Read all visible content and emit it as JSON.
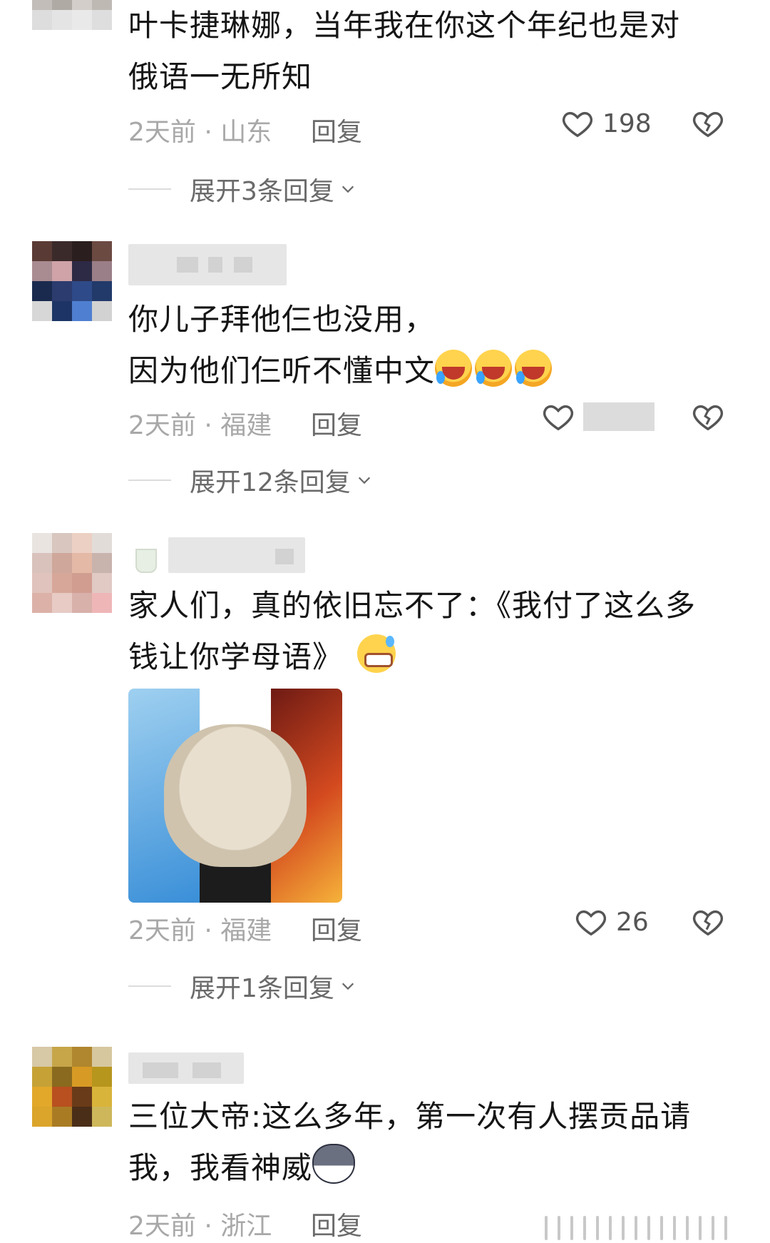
{
  "comments": [
    {
      "text_lines": [
        "叶卡捷琳娜，当年我在你这个年纪也是对",
        "俄语一无所知"
      ],
      "meta": {
        "time_location": "2天前 · 山东",
        "reply_label": "回复"
      },
      "likes": "198",
      "expand_label": "展开3条回复"
    },
    {
      "text_lines": [
        "你儿子拜他仨也没用，",
        "因为他们仨听不懂中文"
      ],
      "meta": {
        "time_location": "2天前 · 福建",
        "reply_label": "回复"
      },
      "likes": "",
      "expand_label": "展开12条回复"
    },
    {
      "text_lines": [
        "家人们，真的依旧忘不了：《我付了这么多",
        "钱让你学母语》"
      ],
      "meta": {
        "time_location": "2天前 · 福建",
        "reply_label": "回复"
      },
      "likes": "26",
      "expand_label": "展开1条回复"
    },
    {
      "text_lines": [
        "三位大帝:这么多年，第一次有人摆贡品请",
        "我，我看神威"
      ],
      "meta": {
        "time_location": "2天前 · 浙江",
        "reply_label": "回复"
      },
      "likes": "",
      "expand_label": ""
    }
  ],
  "colors": {
    "background": "#ffffff",
    "text": "#151515",
    "meta_text": "#a8a8a8",
    "reply_text": "#6a6a6a"
  },
  "icons": {
    "like": "heart-outline-icon",
    "dislike": "broken-heart-icon",
    "expand": "chevron-down-icon"
  }
}
